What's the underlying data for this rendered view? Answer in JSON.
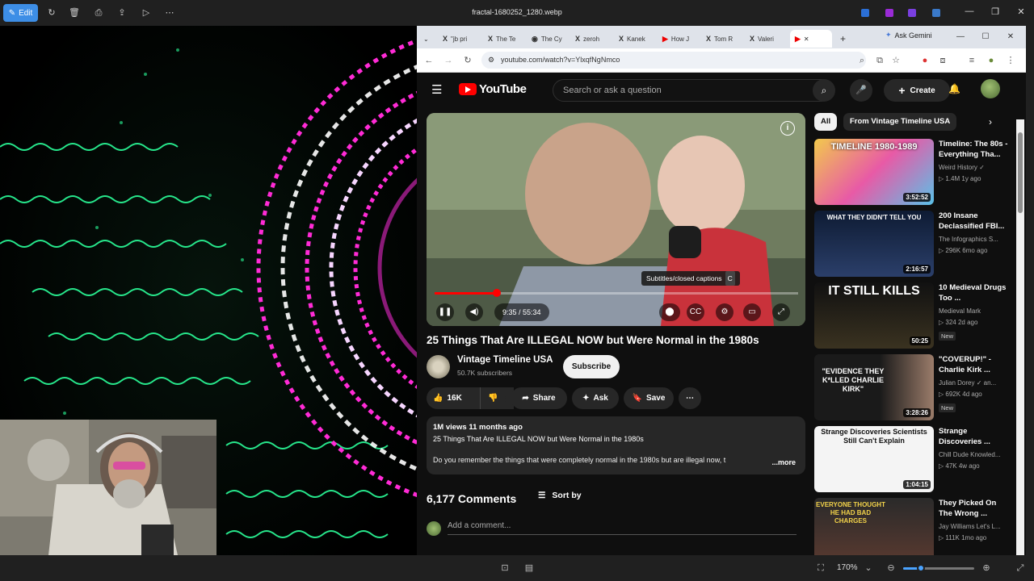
{
  "photos": {
    "edit_label": "Edit",
    "file_title": "fractal-1680252_1280.webp",
    "zoom": "170%",
    "zoom_level": 0.25
  },
  "browser": {
    "tabs": [
      {
        "icon": "X",
        "label": "\"jb pri"
      },
      {
        "icon": "X",
        "label": "The Te"
      },
      {
        "icon": "◉",
        "label": "The Cy"
      },
      {
        "icon": "X",
        "label": "zeroh"
      },
      {
        "icon": "X",
        "label": "Kanek"
      },
      {
        "icon": "▶",
        "label": "How J"
      },
      {
        "icon": "X",
        "label": "Tom R"
      },
      {
        "icon": "X",
        "label": "Valeri"
      }
    ],
    "ask_gemini": "Ask Gemini",
    "url": "youtube.com/watch?v=YlxqfNgNmco"
  },
  "youtube": {
    "logo_text": "YouTube",
    "search_placeholder": "Search or ask a question",
    "create_label": "Create",
    "player": {
      "time": "9:35 / 55:34",
      "progress": 0.172,
      "tooltip": "Subtitles/closed captions",
      "tooltip_key": "C"
    },
    "video_title": "25 Things That Are ILLEGAL NOW but Were Normal in the 1980s",
    "channel": "Vintage Timeline USA",
    "subscribers": "50.7K subscribers",
    "subscribe_label": "Subscribe",
    "likes": "16K",
    "share_label": "Share",
    "ask_label": "Ask",
    "save_label": "Save",
    "description": {
      "meta": "1M views  11 months ago",
      "line1": "25 Things That Are ILLEGAL NOW but Were Normal in the 1980s",
      "line2": "Do you remember the things that were completely normal in the 1980s but are illegal now, t",
      "more": "...more"
    },
    "comments_count": "6,177 Comments",
    "sort_by": "Sort by",
    "add_comment_placeholder": "Add a comment...",
    "chips": [
      "All",
      "From Vintage Timeline USA"
    ],
    "recommendations": [
      {
        "title": "Timeline: The 80s - Everything Tha...",
        "channel": "Weird History ✓",
        "stats": "▷ 1.4M  1y ago",
        "duration": "3:52:52",
        "thumb_text": "TIMELINE 1980-1989",
        "new": ""
      },
      {
        "title": "200 Insane Declassified FBI...",
        "channel": "The Infographics S...",
        "stats": "▷ 296K  6mo ago",
        "duration": "2:16:57",
        "thumb_text": "WHAT THEY DIDN'T TELL YOU",
        "new": ""
      },
      {
        "title": "10 Medieval Drugs Too ...",
        "channel": "Medieval Mark",
        "stats": "▷ 324  2d ago",
        "duration": "50:25",
        "thumb_text": "IT STILL KILLS",
        "new": "New"
      },
      {
        "title": "\"COVERUP!\" - Charlie Kirk ...",
        "channel": "Julian Dorey ✓ an...",
        "stats": "▷ 692K  4d ago",
        "duration": "3:28:26",
        "thumb_text": "\"EVIDENCE THEY K*LLED CHARLIE KIRK\"",
        "new": "New"
      },
      {
        "title": "Strange Discoveries ...",
        "channel": "Chill Dude Knowled...",
        "stats": "▷ 47K  4w ago",
        "duration": "1:04:15",
        "thumb_text": "Strange Discoveries Scientists Still Can't Explain",
        "new": ""
      },
      {
        "title": "They Picked On The Wrong ...",
        "channel": "Jay Williams Let's L...",
        "stats": "▷ 111K  1mo ago",
        "duration": "",
        "thumb_text": "EVERYONE THOUGHT HE HAD BAD CHARGES",
        "new": ""
      }
    ]
  },
  "colors": {
    "accent": "#3d8ee6",
    "yt_red": "#ff0000",
    "fractal_green": "#33ff99",
    "fractal_pink": "#ff2bd6"
  }
}
